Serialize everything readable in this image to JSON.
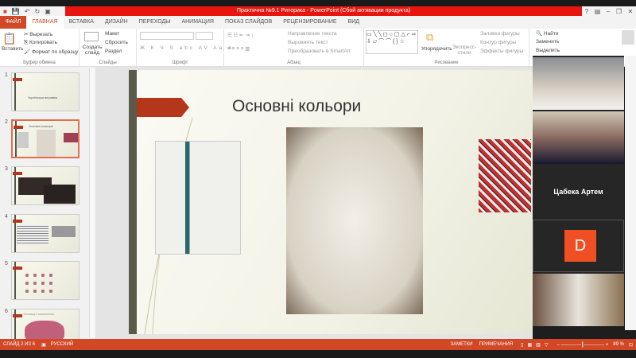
{
  "window": {
    "title": "Практична №9.1 Риторика - PowerPoint (Сбой активации продукта)",
    "help": "?",
    "minimize": "–",
    "restore": "❐",
    "close": "✕"
  },
  "tabs": [
    "ФАЙЛ",
    "ГЛАВНАЯ",
    "ВСТАВКА",
    "ДИЗАЙН",
    "ПЕРЕХОДЫ",
    "АНИМАЦИЯ",
    "ПОКАЗ СЛАЙДОВ",
    "РЕЦЕНЗИРОВАНИЕ",
    "ВИД"
  ],
  "ribbon": {
    "clipboard": {
      "paste": "Вставить",
      "cut": "Вырезать",
      "copy": "Копировать",
      "format": "Формат по образцу",
      "label": "Буфер обмена"
    },
    "slides": {
      "new": "Создать слайд",
      "layout": "Макет",
      "reset": "Сбросить",
      "section": "Раздел",
      "label": "Слайды"
    },
    "font": {
      "label": "Шрифт"
    },
    "paragraph": {
      "direction": "Направление текста",
      "align": "Выровнять текст",
      "smartart": "Преобразовать в SmartArt",
      "label": "Абзац"
    },
    "drawing": {
      "arrange": "Упорядочить",
      "styles": "Экспресс-стили",
      "fill": "Заливка фигуры",
      "outline": "Контур фигуры",
      "effects": "Эффекты фигуры",
      "label": "Рисование"
    },
    "editing": {
      "find": "Найти",
      "replace": "Заменить",
      "select": "Выделить"
    }
  },
  "thumbnails": [
    {
      "num": "1",
      "title": "Українська вишивка"
    },
    {
      "num": "2",
      "title": "Основні кольори"
    },
    {
      "num": "3",
      "title": ""
    },
    {
      "num": "4",
      "title": ""
    },
    {
      "num": "5",
      "title": ""
    },
    {
      "num": "6",
      "title": "Заповідні вишивання"
    }
  ],
  "slide": {
    "title": "Основні кольори"
  },
  "video": {
    "participant_name": "Цабека Артем",
    "avatar_letter": "D",
    "accent": "#f04e23"
  },
  "status": {
    "slide": "СЛАЙД 2 ИЗ 6",
    "lang": "РУССКИЙ",
    "notes": "ЗАМЕТКИ",
    "comments": "ПРИМЕЧАНИЯ",
    "zoom": "89 %"
  },
  "colors": {
    "brand": "#d24726",
    "title_red": "#e8140e"
  }
}
